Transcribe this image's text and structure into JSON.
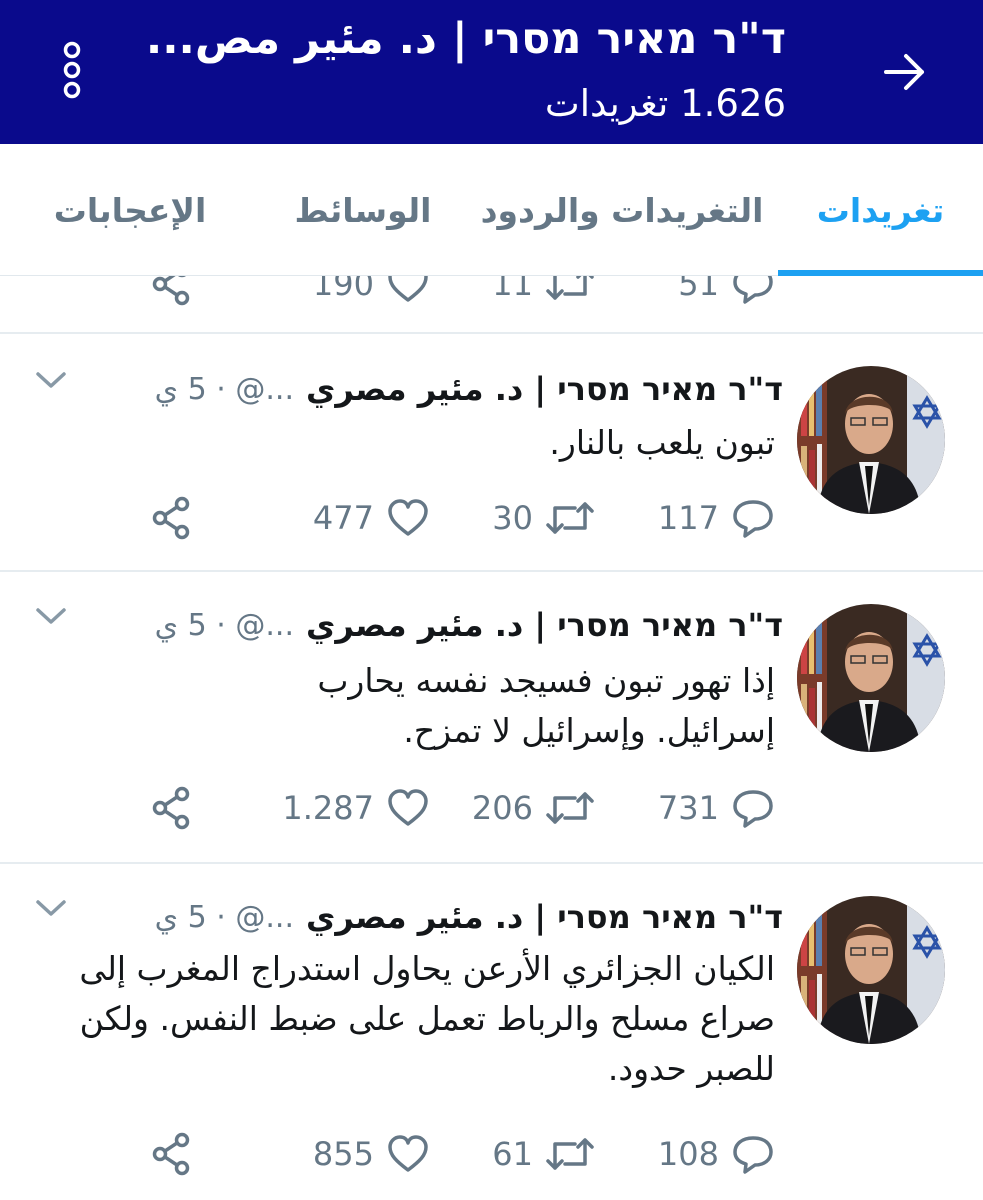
{
  "header": {
    "title": "ד\"ר מאיר מסרי | د. مئير مص...",
    "subtitle": "1.626 تغريدات",
    "back_icon": "arrow-right-icon",
    "menu_icon": "more-vertical-icon"
  },
  "tabs": [
    {
      "label": "تغريدات",
      "active": true
    },
    {
      "label": "التغريدات والردود",
      "active": false
    },
    {
      "label": "الوسائط",
      "active": false
    },
    {
      "label": "الإعجابات",
      "active": false
    }
  ],
  "partial_tweet": {
    "replies": "51",
    "retweets": "11",
    "likes": "190"
  },
  "tweets": [
    {
      "name": "ד\"ר מאיר מסרי | د. مئير مصري",
      "meta": "...@ · 5 ي",
      "text": "تبون يلعب بالنار.",
      "replies": "117",
      "retweets": "30",
      "likes": "477"
    },
    {
      "name": "ד\"ר מאיר מסרי | د. مئير مصري",
      "meta": "...@ · 5 ي",
      "text": "إذا تهور تبون فسيجد نفسه يحارب إسرائيل. وإسرائيل لا تمزح.",
      "replies": "731",
      "retweets": "206",
      "likes": "1.287"
    },
    {
      "name": "ד\"ר מאיר מסרי | د. مئير مصري",
      "meta": "...@ · 5 ي",
      "text": "الكيان الجزائري الأرعن يحاول استدراج المغرب إلى صراع مسلح والرباط تعمل على ضبط النفس. ولكن للصبر حدود.",
      "replies": "108",
      "retweets": "61",
      "likes": "855"
    }
  ],
  "colors": {
    "header_bg": "#0a0a8c",
    "accent": "#1da1f2",
    "secondary_text": "#657786",
    "divider": "#e6ecf0"
  }
}
